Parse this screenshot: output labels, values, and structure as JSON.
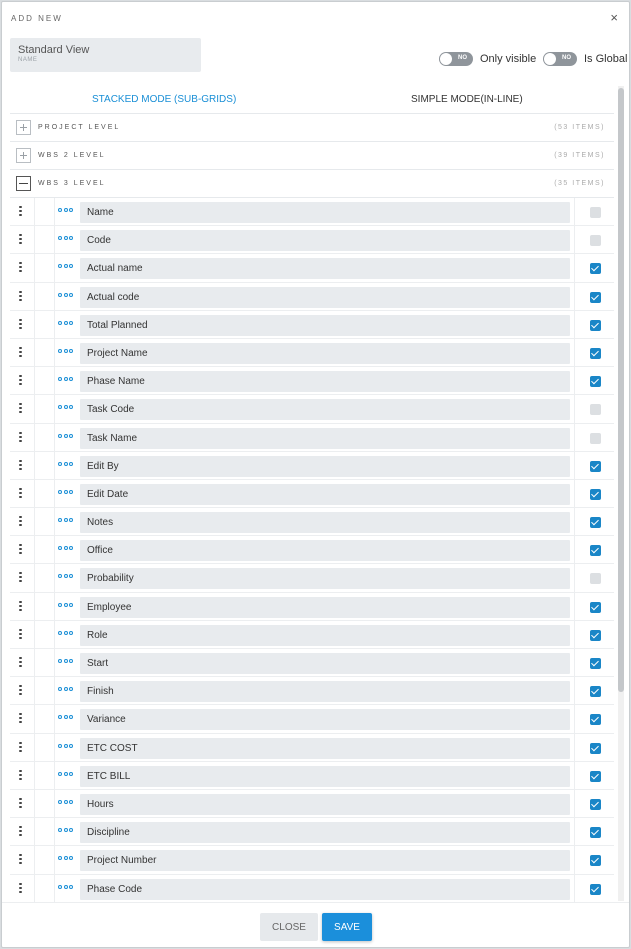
{
  "dialog": {
    "title": "ADD NEW",
    "close_glyph": "×",
    "name_value": "Standard View",
    "name_label": "NAME"
  },
  "toggles": [
    {
      "state": "NO",
      "label": "Only visible"
    },
    {
      "state": "NO",
      "label": "Is Global"
    }
  ],
  "tabs": {
    "stacked": "STACKED MODE (SUB-GRIDS)",
    "simple": "SIMPLE MODE(IN-LINE)"
  },
  "levels": [
    {
      "label": "PROJECT LEVEL",
      "count": "(53 ITEMS)",
      "expanded": false
    },
    {
      "label": "WBS 2 LEVEL",
      "count": "(39 ITEMS)",
      "expanded": false
    },
    {
      "label": "WBS 3 LEVEL",
      "count": "(35 ITEMS)",
      "expanded": true
    }
  ],
  "fields": [
    {
      "name": "Name",
      "checked": false
    },
    {
      "name": "Code",
      "checked": false
    },
    {
      "name": "Actual name",
      "checked": true
    },
    {
      "name": "Actual code",
      "checked": true
    },
    {
      "name": "Total Planned",
      "checked": true
    },
    {
      "name": "Project Name",
      "checked": true
    },
    {
      "name": "Phase Name",
      "checked": true
    },
    {
      "name": "Task Code",
      "checked": false
    },
    {
      "name": "Task Name",
      "checked": false
    },
    {
      "name": "Edit By",
      "checked": true
    },
    {
      "name": "Edit Date",
      "checked": true
    },
    {
      "name": "Notes",
      "checked": true
    },
    {
      "name": "Office",
      "checked": true
    },
    {
      "name": "Probability",
      "checked": false
    },
    {
      "name": "Employee",
      "checked": true
    },
    {
      "name": "Role",
      "checked": true
    },
    {
      "name": "Start",
      "checked": true
    },
    {
      "name": "Finish",
      "checked": true
    },
    {
      "name": "Variance",
      "checked": true
    },
    {
      "name": "ETC COST",
      "checked": true
    },
    {
      "name": "ETC BILL",
      "checked": true
    },
    {
      "name": "Hours",
      "checked": true
    },
    {
      "name": "Discipline",
      "checked": true
    },
    {
      "name": "Project Number",
      "checked": true
    },
    {
      "name": "Phase Code",
      "checked": true
    }
  ],
  "footer": {
    "close_label": "CLOSE",
    "save_label": "SAVE"
  },
  "colors": {
    "accent": "#1a8fd6",
    "checkbox_on": "#1a86c7",
    "field_bg": "#e8ebee"
  }
}
